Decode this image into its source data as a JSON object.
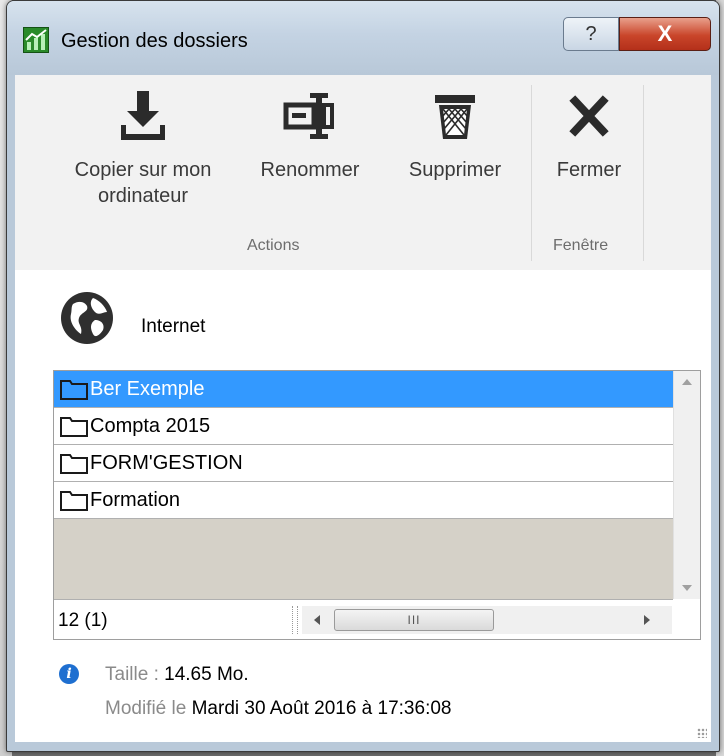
{
  "window": {
    "title": "Gestion des dossiers",
    "help_label": "?",
    "close_label": "X"
  },
  "ribbon": {
    "buttons": {
      "copy_line1": "Copier sur mon",
      "copy_line2": "ordinateur",
      "rename": "Renommer",
      "delete": "Supprimer",
      "close": "Fermer"
    },
    "groups": {
      "actions": "Actions",
      "window": "Fenêtre"
    }
  },
  "location": {
    "label": "Internet",
    "icon": "globe-icon"
  },
  "folders": {
    "items": [
      {
        "label": "Ber Exemple",
        "selected": true
      },
      {
        "label": "Compta 2015",
        "selected": false
      },
      {
        "label": "FORM'GESTION",
        "selected": false
      },
      {
        "label": "Formation",
        "selected": false
      }
    ],
    "count": "12 (1)",
    "hscroll_thumb": "III"
  },
  "details": {
    "size_label": "Taille :",
    "size_value": "14.65 Mo.",
    "modified_label": "Modifié le",
    "modified_value": "Mardi 30 Août 2016 à 17:36:08"
  },
  "colors": {
    "selection": "#3399ff",
    "close_button": "#c9452a",
    "info_icon": "#1e6fd0"
  }
}
